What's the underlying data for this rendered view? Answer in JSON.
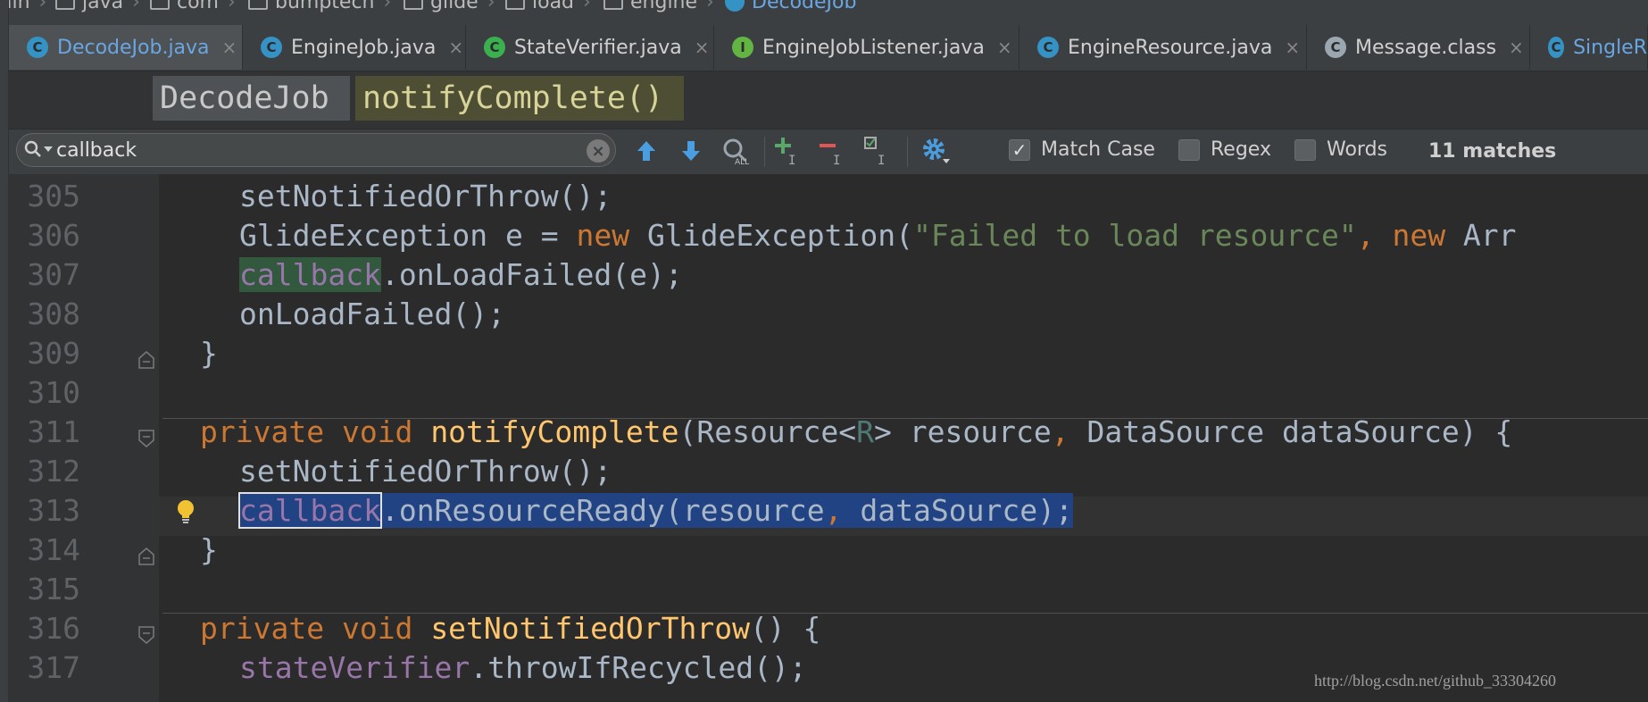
{
  "breadcrumb": {
    "items": [
      {
        "label": "ain",
        "icon": "none"
      },
      {
        "label": "java",
        "icon": "folder-icon"
      },
      {
        "label": "com",
        "icon": "folder-icon"
      },
      {
        "label": "bumptech",
        "icon": "folder-icon"
      },
      {
        "label": "glide",
        "icon": "folder-icon"
      },
      {
        "label": "load",
        "icon": "folder-icon"
      },
      {
        "label": "engine",
        "icon": "folder-icon"
      },
      {
        "label": "DecodeJob",
        "icon": "class-icon"
      }
    ]
  },
  "tabs": [
    {
      "label": "DecodeJob.java",
      "icon_letter": "C",
      "icon_color": "#3592c4",
      "active": true
    },
    {
      "label": "EngineJob.java",
      "icon_letter": "C",
      "icon_color": "#3592c4",
      "active": false
    },
    {
      "label": "StateVerifier.java",
      "icon_letter": "C",
      "icon_color": "#3bb04f",
      "active": false
    },
    {
      "label": "EngineJobListener.java",
      "icon_letter": "I",
      "icon_color": "#62b543",
      "active": false
    },
    {
      "label": "EngineResource.java",
      "icon_letter": "C",
      "icon_color": "#3592c4",
      "active": false
    },
    {
      "label": "Message.class",
      "icon_letter": "C",
      "icon_color": "#9aa7b0",
      "active": false
    },
    {
      "label": "SingleR",
      "icon_letter": "C",
      "icon_color": "#3592c4",
      "active": false
    }
  ],
  "tab_close_glyph": "×",
  "navbar": {
    "class_name": "DecodeJob",
    "method_name": "notifyComplete()"
  },
  "search": {
    "value": "callback",
    "clear_glyph": "×",
    "match_case_label": "Match Case",
    "match_case_checked": true,
    "regex_label": "Regex",
    "regex_checked": false,
    "words_label": "Words",
    "words_checked": false,
    "match_count": "11 matches"
  },
  "editor": {
    "line_numbers": [
      "305",
      "306",
      "307",
      "308",
      "309",
      "310",
      "311",
      "312",
      "313",
      "314",
      "315",
      "316",
      "317"
    ],
    "lines": {
      "l305": "setNotifiedOrThrow();",
      "l306_a": "GlideException e = ",
      "l306_kw": "new",
      "l306_b": " GlideException(",
      "l306_str": "\"Failed to load resource\"",
      "l306_c": ", ",
      "l306_kw2": "new",
      "l306_d": " Arr",
      "l307_hl": "callback",
      "l307_b": ".onLoadFailed(e);",
      "l308": "onLoadFailed();",
      "l309": "}",
      "l311_kw1": "private",
      "l311_kw2": "void",
      "l311_fn": "notifyComplete",
      "l311_a": "(Resource<",
      "l311_gen": "R",
      "l311_b": "> resource",
      "l311_c": ", ",
      "l311_d": "DataSource dataSource) {",
      "l312": "setNotifiedOrThrow();",
      "l313_hl": "callback",
      "l313_b": ".onResourceReady(resource",
      "l313_c": ", ",
      "l313_d": "dataSource);",
      "l314": "}",
      "l316_kw1": "private",
      "l316_kw2": "void",
      "l316_fn": "setNotifiedOrThrow",
      "l316_b": "() {",
      "l317_fld": "stateVerifier",
      "l317_b": ".throwIfRecycled();"
    }
  },
  "watermark": "http://blog.csdn.net/github_33304260",
  "colors": {
    "editor_bg": "#2b2b2b",
    "keyword": "#cc7832",
    "function": "#ffc66d",
    "string": "#6a8759",
    "field": "#9876aa",
    "selection": "#214283"
  }
}
